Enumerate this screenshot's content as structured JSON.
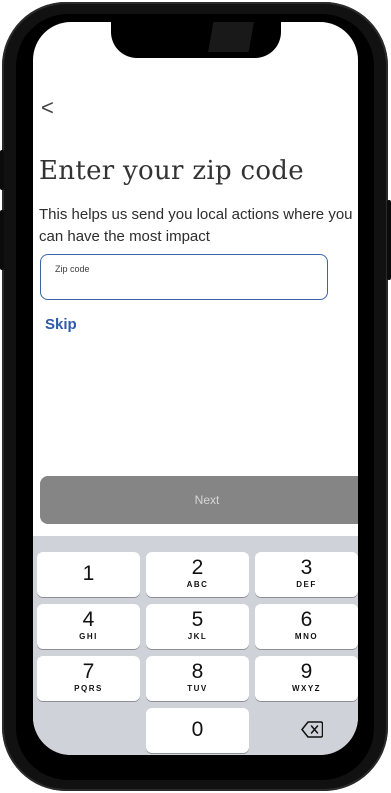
{
  "header": {
    "back_icon": "chevron-left-icon",
    "back_glyph": "<"
  },
  "main": {
    "title": "Enter your zip code",
    "subtitle": "This helps us send you local actions where you can have the most impact",
    "zip_field": {
      "label": "Zip code",
      "value": ""
    },
    "skip_label": "Skip",
    "next_label": "Next"
  },
  "keypad": {
    "keys": [
      {
        "digit": "1",
        "letters": ""
      },
      {
        "digit": "2",
        "letters": "ABC"
      },
      {
        "digit": "3",
        "letters": "DEF"
      },
      {
        "digit": "4",
        "letters": "GHI"
      },
      {
        "digit": "5",
        "letters": "JKL"
      },
      {
        "digit": "6",
        "letters": "MNO"
      },
      {
        "digit": "7",
        "letters": "PQRS"
      },
      {
        "digit": "8",
        "letters": "TUV"
      },
      {
        "digit": "9",
        "letters": "WXYZ"
      },
      {
        "digit": "0",
        "letters": ""
      }
    ],
    "backspace_icon": "backspace-icon"
  },
  "colors": {
    "accent": "#2f5aa8",
    "field_border": "#3a64a8",
    "next_bg": "#858585",
    "keypad_bg": "#cfd2d8"
  }
}
